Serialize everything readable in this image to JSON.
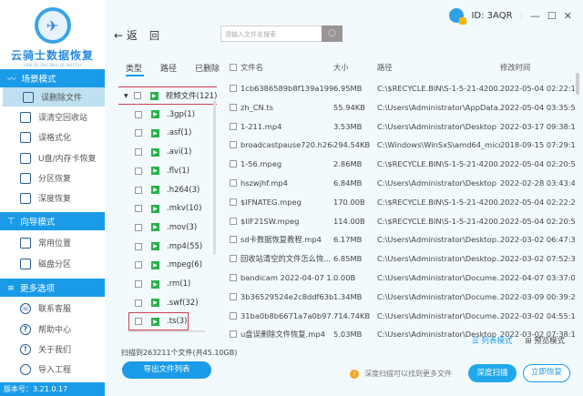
{
  "app": {
    "name": "云骑士数据恢复",
    "pinyin": "YUN QI SHI SHU JU HUI FU",
    "user_id": "ID: 3AQR",
    "version": "版本号：3.21.0.17"
  },
  "sidebar": {
    "sections": [
      {
        "label": "场景模式",
        "items": [
          "误删除文件",
          "误清空回收站",
          "误格式化",
          "U盘/内存卡恢复",
          "分区恢复",
          "深度恢复"
        ]
      },
      {
        "label": "向导模式",
        "items": [
          "常用位置",
          "磁盘分区"
        ]
      },
      {
        "label": "更多选项",
        "items": [
          "联系客服",
          "帮助中心",
          "关于我们",
          "导入工程"
        ]
      }
    ],
    "active": "误删除文件"
  },
  "toolbar": {
    "back": "返",
    "refresh": "回",
    "search_placeholder": "请输入文件名搜索"
  },
  "tree": {
    "tabs": [
      "类型",
      "路径",
      "已删除"
    ],
    "items": [
      {
        "label": "视频文件(121)",
        "parent": true
      },
      {
        "label": ".3gp(1)"
      },
      {
        "label": ".asf(1)"
      },
      {
        "label": ".avi(1)"
      },
      {
        "label": ".flv(1)"
      },
      {
        "label": ".h264(3)"
      },
      {
        "label": ".mkv(10)"
      },
      {
        "label": ".mov(3)"
      },
      {
        "label": ".mp4(55)"
      },
      {
        "label": ".mpeg(6)"
      },
      {
        "label": ".rm(1)"
      },
      {
        "label": ".swf(32)"
      },
      {
        "label": ".ts(3)"
      }
    ]
  },
  "status": {
    "scan": "扫描到263211个文件(共45.10GB)",
    "export": "导出文件列表"
  },
  "table": {
    "headers": [
      "文件名",
      "大小",
      "路径",
      "修改时间"
    ],
    "rows": [
      [
        "1cb6386589b8f139a199...",
        "6.95MB",
        "C:\\$RECYCLE.BIN\\S-1-5-21-4200...",
        "2022-05-04 02:22:15"
      ],
      [
        "zh_CN.ts",
        "55.94KB",
        "C:\\Users\\Administrator\\AppData...",
        "2022-05-04 03:35:54"
      ],
      [
        "1-211.mp4",
        "3.53MB",
        "C:\\Users\\Administrator\\Desktop",
        "2022-03-17 09:38:13"
      ],
      [
        "broadcastpause720.h264",
        "294.54KB",
        "C:\\Windows\\WinSxS\\amd64_micr...",
        "2018-09-15 07:29:13"
      ],
      [
        "1-56.mpeg",
        "2.86MB",
        "C:\\$RECYCLE.BIN\\S-1-5-21-4200...",
        "2022-05-04 02:20:50"
      ],
      [
        "hszwjhf.mp4",
        "6.84MB",
        "C:\\Users\\Administrator\\Desktop",
        "2022-02-28 03:43:42"
      ],
      [
        "$IFNATEG.mpeg",
        "170.00B",
        "C:\\$RECYCLE.BIN\\S-1-5-21-4200...",
        "2022-05-04 02:22:20"
      ],
      [
        "$IIF21SW.mpeg",
        "114.00B",
        "C:\\$RECYCLE.BIN\\S-1-5-21-4200...",
        "2022-05-04 02:20:56"
      ],
      [
        "sd卡数据恢复教程.mp4",
        "6.17MB",
        "C:\\Users\\Administrator\\Desktop...",
        "2022-03-02 06:47:31"
      ],
      [
        "回收站清空的文件怎么恢...",
        "6.85MB",
        "C:\\Users\\Administrator\\Desktop...",
        "2022-03-02 07:52:32"
      ],
      [
        "bandicam 2022-04-07 1...",
        "0.00B",
        "C:\\Users\\Administrator\\Docume...",
        "2022-04-07 03:37:04"
      ],
      [
        "3b36529524e2c8ddf63b...",
        "1.34MB",
        "C:\\Users\\Administrator\\Docume...",
        "2022-03-09 00:39:20"
      ],
      [
        "31ba0b8b6671a7a0b97...",
        "714.74KB",
        "C:\\Users\\Administrator\\Docume...",
        "2022-03-02 04:55:18"
      ],
      [
        "u盘误删除文件恢复.mp4",
        "5.03MB",
        "C:\\Users\\Administrator\\Desktop",
        "2022-03-02 07:38:11"
      ]
    ]
  },
  "view": {
    "list": "列表模式",
    "preview": "预览模式"
  },
  "footer": {
    "hint": "深度扫描可以找到更多文件",
    "deep_scan": "深度扫描",
    "recover": "立即恢复"
  }
}
